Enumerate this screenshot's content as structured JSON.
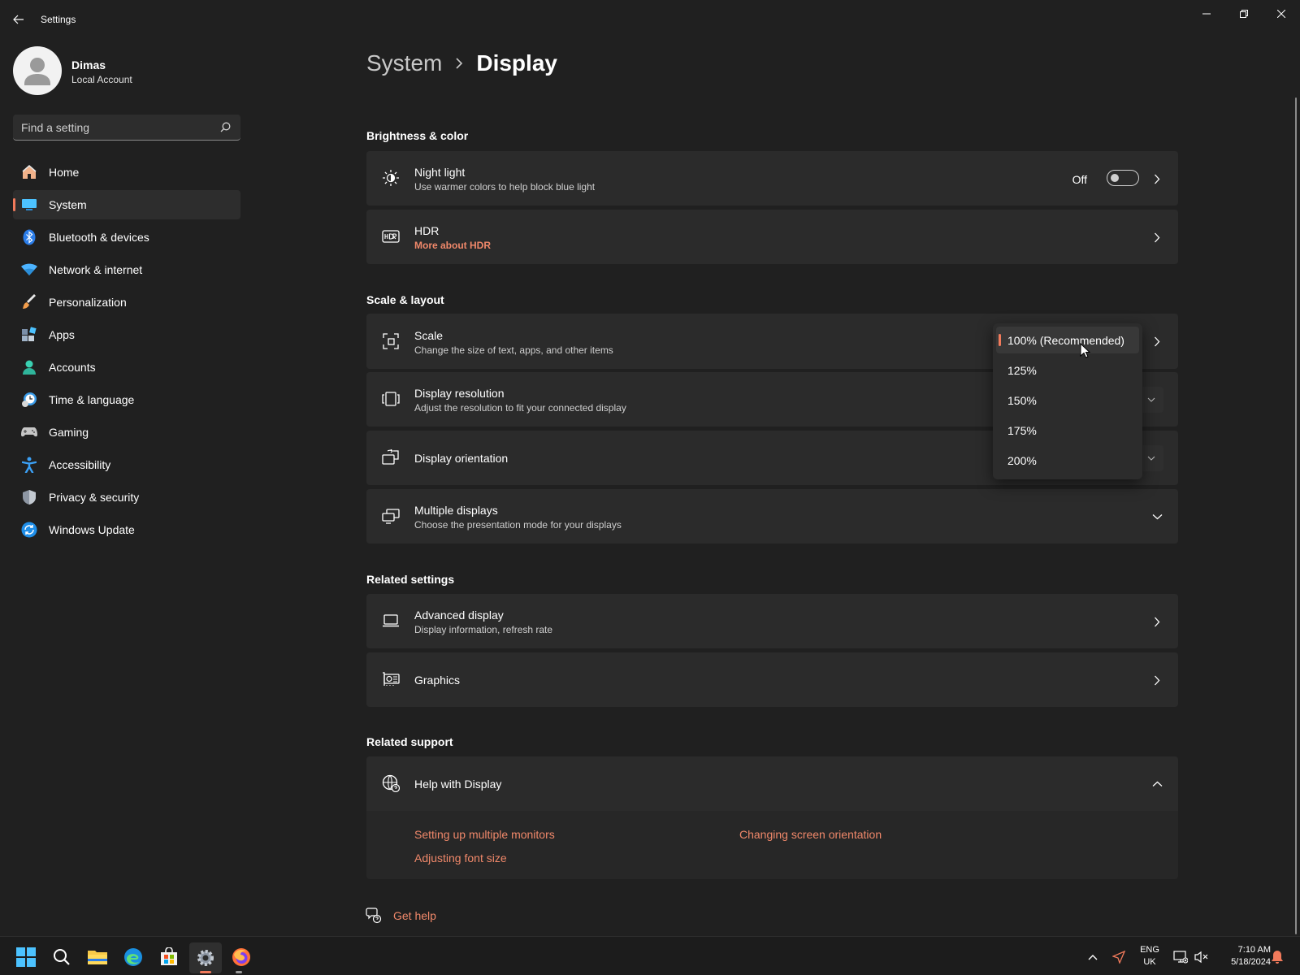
{
  "window": {
    "title": "Settings"
  },
  "profile": {
    "name": "Dimas",
    "account_type": "Local Account"
  },
  "search": {
    "placeholder": "Find a setting"
  },
  "nav": {
    "items": [
      {
        "label": "Home",
        "icon": "home-icon"
      },
      {
        "label": "System",
        "icon": "system-icon",
        "selected": true
      },
      {
        "label": "Bluetooth & devices",
        "icon": "bluetooth-icon"
      },
      {
        "label": "Network & internet",
        "icon": "network-icon"
      },
      {
        "label": "Personalization",
        "icon": "brush-icon"
      },
      {
        "label": "Apps",
        "icon": "apps-icon"
      },
      {
        "label": "Accounts",
        "icon": "accounts-icon"
      },
      {
        "label": "Time & language",
        "icon": "clock-icon"
      },
      {
        "label": "Gaming",
        "icon": "gamepad-icon"
      },
      {
        "label": "Accessibility",
        "icon": "accessibility-icon"
      },
      {
        "label": "Privacy & security",
        "icon": "shield-icon"
      },
      {
        "label": "Windows Update",
        "icon": "update-icon"
      }
    ]
  },
  "breadcrumb": {
    "parent": "System",
    "current": "Display"
  },
  "sections": {
    "brightness": "Brightness & color",
    "scale_layout": "Scale & layout",
    "related_settings": "Related settings",
    "related_support": "Related support"
  },
  "cards": {
    "night_light": {
      "title": "Night light",
      "subtitle": "Use warmer colors to help block blue light",
      "toggle_state": "Off"
    },
    "hdr": {
      "title": "HDR",
      "subtitle": "More about HDR"
    },
    "scale": {
      "title": "Scale",
      "subtitle": "Change the size of text, apps, and other items"
    },
    "resolution": {
      "title": "Display resolution",
      "subtitle": "Adjust the resolution to fit your connected display"
    },
    "orientation": {
      "title": "Display orientation"
    },
    "multiple": {
      "title": "Multiple displays",
      "subtitle": "Choose the presentation mode for your displays"
    },
    "advanced": {
      "title": "Advanced display",
      "subtitle": "Display information, refresh rate"
    },
    "graphics": {
      "title": "Graphics"
    },
    "help": {
      "title": "Help with Display"
    }
  },
  "scale_menu": {
    "options": [
      "100% (Recommended)",
      "125%",
      "150%",
      "175%",
      "200%"
    ],
    "selected_index": 0
  },
  "help_links": {
    "multiple_monitors": "Setting up multiple monitors",
    "orientation": "Changing screen orientation",
    "font_size": "Adjusting font size"
  },
  "get_help": "Get help",
  "tray": {
    "lang_line1": "ENG",
    "lang_line2": "UK",
    "time": "7:10 AM",
    "date": "5/18/2024"
  },
  "colors": {
    "accent": "#f17a5b",
    "link": "#f0886a",
    "background": "#202020",
    "card": "#2b2b2b"
  }
}
